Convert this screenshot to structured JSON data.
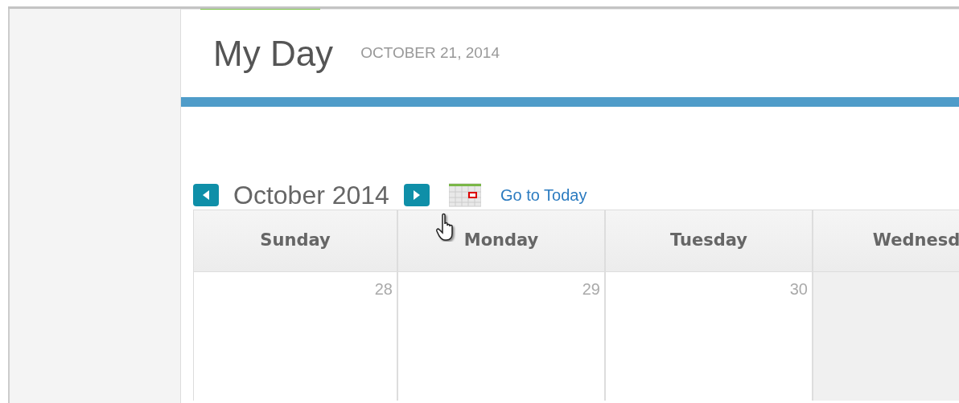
{
  "page_title": "My Day",
  "date": "OCTOBER 21, 2014",
  "calendar": {
    "month": "October 2014",
    "go_to_today": "Go to Today",
    "weekdays": [
      "Sunday",
      "Monday",
      "Tuesday",
      "Wednesd"
    ],
    "days": [
      {
        "number": "28",
        "shaded": false
      },
      {
        "number": "29",
        "shaded": false
      },
      {
        "number": "30",
        "shaded": false
      },
      {
        "shaded": true
      }
    ]
  }
}
